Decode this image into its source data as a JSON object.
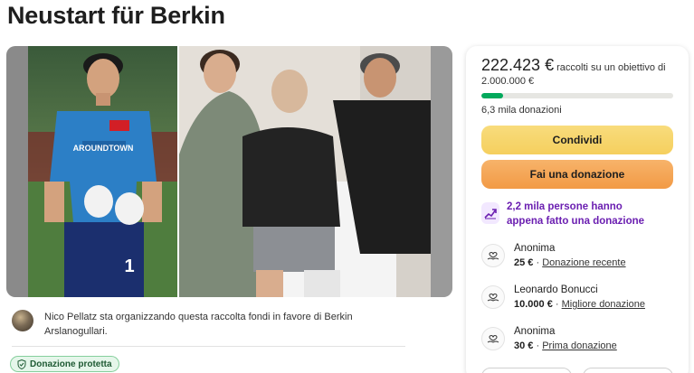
{
  "page": {
    "title": "Neustart für Berkin"
  },
  "hero": {
    "jersey_text": "AROUNDTOWN",
    "jersey_number": "1"
  },
  "panel": {
    "amount": "222.423 €",
    "raised_suffix": "raccolti su un obiettivo di",
    "goal": "2.000.000 €",
    "progress_fraction": 0.111,
    "donations_count": "6,3 mila donazioni",
    "share_label": "Condividi",
    "donate_label": "Fai una donazione",
    "trend_text": "2,2 mila persone hanno appena fatto una donazione",
    "donors": [
      {
        "name": "Anonima",
        "amount": "25 €",
        "separator": "·",
        "label": "Donazione recente"
      },
      {
        "name": "Leonardo Bonucci",
        "amount": "10.000 €",
        "separator": "·",
        "label": "Migliore donazione"
      },
      {
        "name": "Anonima",
        "amount": "30 €",
        "separator": "·",
        "label": "Prima donazione"
      }
    ]
  },
  "organizer": {
    "text": "Nico Pellatz sta organizzando questa raccolta fondi in favore di Berkin Arslanogullari."
  },
  "badge": {
    "label": "Donazione protetta"
  },
  "colors": {
    "accent_green": "#02a95c",
    "trend_purple": "#6b1fb1",
    "share_yellow": "#f5cf5e",
    "donate_orange": "#f29a45"
  },
  "icons": {
    "trend": "trending-up-icon",
    "donor": "heart-hands-icon",
    "badge": "shield-check-icon"
  }
}
